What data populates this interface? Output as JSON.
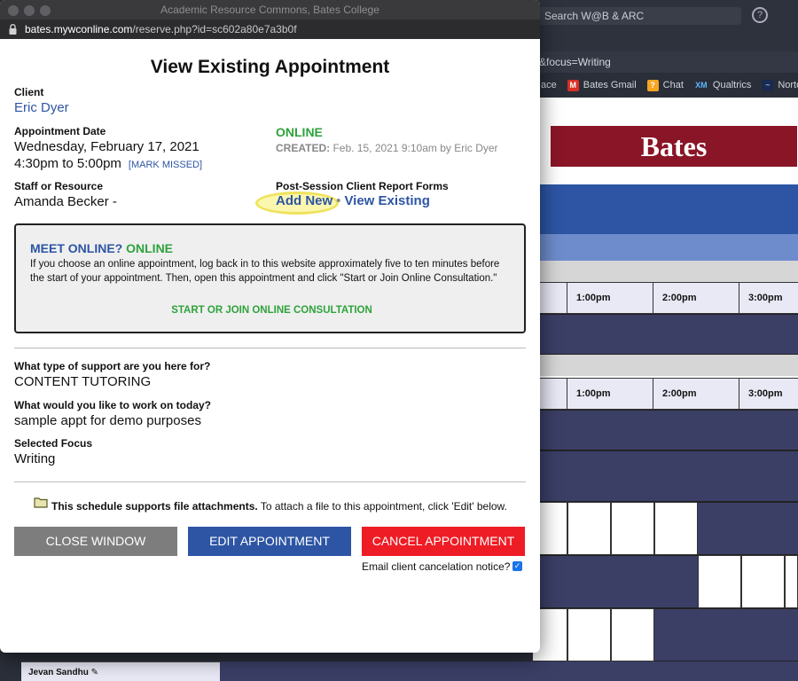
{
  "background": {
    "search_box_text": "Search W@B & ARC",
    "address_fragment": "&focus=Writing",
    "bookmarks": [
      {
        "icon": "",
        "label": "ace"
      },
      {
        "icon": "M",
        "label": "Bates Gmail"
      },
      {
        "icon": "?",
        "label": "Chat"
      },
      {
        "icon": "XM",
        "label": "Qualtrics"
      },
      {
        "icon": "~",
        "label": "Norto"
      }
    ],
    "logo_text": "Bates",
    "time_headers": [
      "1:00pm",
      "2:00pm",
      "3:00pm"
    ],
    "row_name": "Jevan Sandhu"
  },
  "popup": {
    "window_title": "Academic Resource Commons, Bates College",
    "url_host": "bates.mywconline.com",
    "url_path": "/reserve.php?id=sc602a80e7a3b0f",
    "page_title": "View Existing Appointment",
    "client_label": "Client",
    "client_name": "Eric Dyer",
    "appt_date_label": "Appointment Date",
    "appt_date": "Wednesday, February 17, 2021",
    "appt_time": "4:30pm to 5:00pm",
    "mark_missed": "[MARK MISSED]",
    "online_status": "ONLINE",
    "created_label": "CREATED:",
    "created_value": "Feb. 15, 2021 9:10am by Eric Dyer",
    "staff_label": "Staff or Resource",
    "staff_name": "Amanda Becker -",
    "forms_label": "Post-Session Client Report Forms",
    "add_new": "Add New",
    "separator": "•",
    "view_existing": "View Existing",
    "meet_question": "MEET ONLINE?",
    "meet_status": "ONLINE",
    "meet_text": "If you choose an online appointment, log back in to this website approximately five to ten minutes before the start of your appointment. Then, open this appointment and click \"Start or Join Online Consultation.\"",
    "join_link": "START OR JOIN ONLINE CONSULTATION",
    "support_label": "What type of support are you here for?",
    "support_value": "CONTENT TUTORING",
    "work_label": "What would you like to work on today?",
    "work_value": "sample appt for demo purposes",
    "focus_label": "Selected Focus",
    "focus_value": "Writing",
    "attach_bold": "This schedule supports file attachments.",
    "attach_rest": " To attach a file to this appointment, click 'Edit' below.",
    "close_button": "CLOSE WINDOW",
    "edit_button": "EDIT APPOINTMENT",
    "cancel_button": "CANCEL APPOINTMENT",
    "email_notice": "Email client cancelation notice?",
    "email_checked": "✓"
  },
  "colors": {
    "link_blue": "#2d55a4",
    "online_green": "#2ea33c",
    "cancel_red": "#ee1c25",
    "close_grey": "#7d7d7d",
    "bates_maroon": "#8a1527",
    "navy_block": "#3b3f66"
  }
}
